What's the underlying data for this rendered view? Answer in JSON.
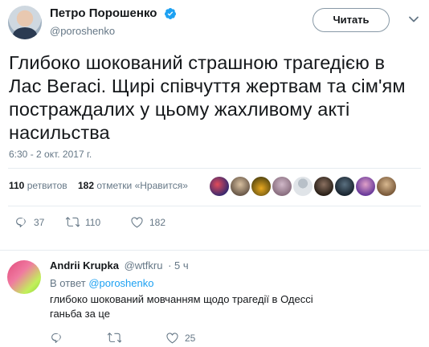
{
  "tweet": {
    "display_name": "Петро Порошенко",
    "handle": "@poroshenko",
    "follow_label": "Читать",
    "text": "Глибоко шокований страшною трагедією в Лас Вегасі. Щирі співчуття жертвам та сім'ям постраждалих у цьому жахливому акті насильства",
    "timestamp": "6:30 - 2 окт. 2017 г.",
    "retweets_count": "110",
    "retweets_label": "ретвитов",
    "likes_count": "182",
    "likes_label": "отметки «Нравится»",
    "actions": {
      "reply_count": "37",
      "retweet_count": "110",
      "like_count": "182"
    },
    "colors": {
      "accent": "#1da1f2",
      "muted": "#657786",
      "text": "#14171a"
    }
  },
  "reply": {
    "display_name": "Andrii Krupka",
    "handle": "@wtfkru",
    "time": "· 5 ч",
    "reply_prefix": "В ответ",
    "reply_mention": "@poroshenko",
    "text_line1": "глибоко шокований мовчанням щодо трагедії в Одессі",
    "text_line2": "ганьба за це",
    "actions": {
      "reply_count": "",
      "retweet_count": "",
      "like_count": "25"
    }
  },
  "icons": [
    "verified-icon",
    "caret-down-icon",
    "reply-icon",
    "retweet-icon",
    "like-icon"
  ]
}
